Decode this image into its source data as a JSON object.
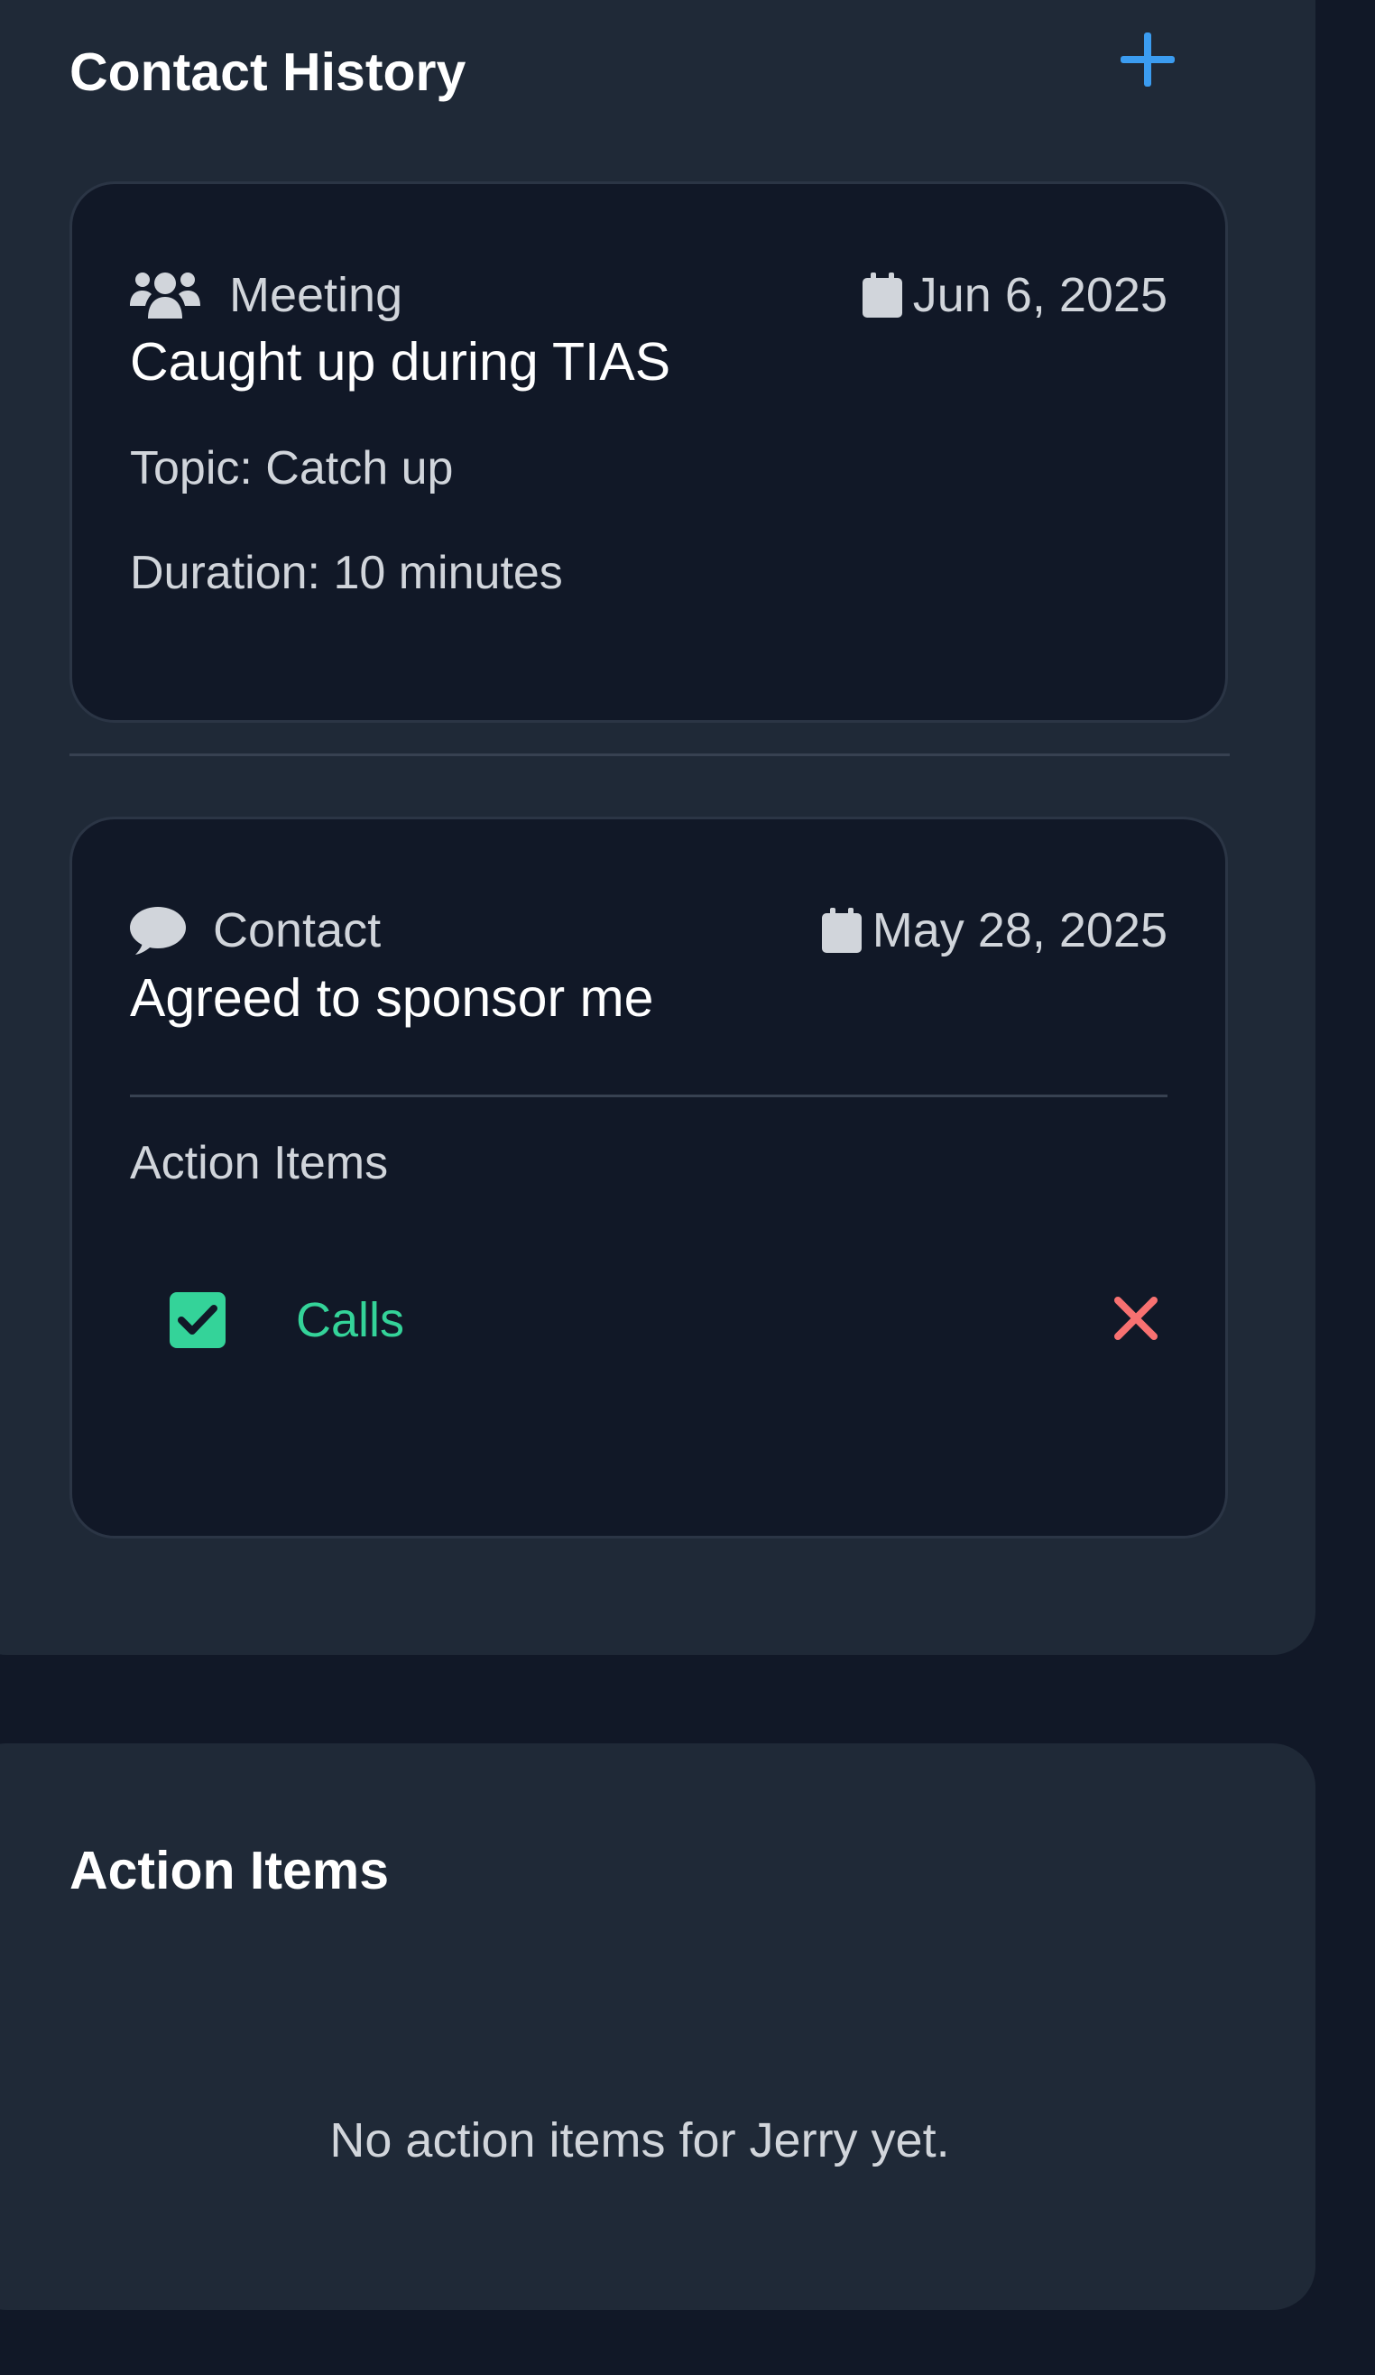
{
  "contact_history": {
    "title": "Contact History",
    "add_icon": "plus-icon",
    "entries": [
      {
        "type": "Meeting",
        "type_icon": "users-icon",
        "date_icon": "calendar-icon",
        "date": "Jun 6, 2025",
        "summary": "Caught up during TIAS",
        "topic": "Topic: Catch up",
        "duration": "Duration: 10 minutes"
      },
      {
        "type": "Contact",
        "type_icon": "comment-icon",
        "date_icon": "calendar-icon",
        "date": "May 28, 2025",
        "summary": "Agreed to sponsor me",
        "action_items_heading": "Action Items",
        "action_items": [
          {
            "text": "Calls",
            "checked": true,
            "check_icon": "checkbox-checked-icon",
            "delete_icon": "close-icon"
          }
        ]
      }
    ]
  },
  "action_items_panel": {
    "title": "Action Items",
    "empty_message": "No action items for Jerry yet."
  },
  "colors": {
    "page_background": "#111827",
    "panel_background": "#1f2937",
    "card_background": "#111827",
    "accent_blue": "#3b9cf0",
    "success_green": "#34d399",
    "danger_red": "#f87171",
    "text_primary": "#ffffff",
    "text_secondary": "#d1d5db"
  }
}
